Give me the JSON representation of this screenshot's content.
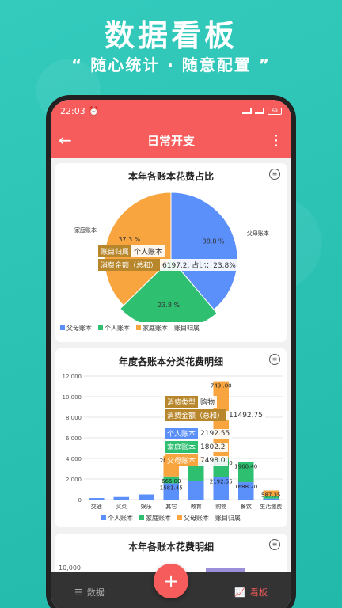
{
  "promo": {
    "title": "数据看板",
    "subtitle": "“ 随心统计 · 随意配置 ”"
  },
  "statusbar": {
    "time": "22:03",
    "battery": "69"
  },
  "appbar": {
    "title": "日常开支"
  },
  "colors": {
    "accent": "#f65c5b",
    "blue": "#5b8ff9",
    "green": "#2fbf71",
    "orange": "#f8a540",
    "brown": "#b8862b",
    "darkbrown": "#8a6d3b"
  },
  "pie_card": {
    "title": "本年各账本花费占比",
    "tooltip": {
      "k1": "账目归属",
      "v1": "个人账本",
      "k2": "消费金额（总和）",
      "v2": "6197.2, 占比：23.8%"
    },
    "legend": [
      "父母账本",
      "个人账本",
      "家庭账本",
      "账目归属"
    ]
  },
  "bar_card": {
    "title": "年度各账本分类花费明细",
    "tooltip": {
      "k1": "消费类型",
      "v1": "购物",
      "k2": "消费金额（总和）",
      "v2": "11492.75",
      "r1k": "个人账本",
      "r1v": "2192.55",
      "r2k": "家庭账本",
      "r2v": "1802.2",
      "r3k": "父母账本",
      "r3v": "7498.0"
    },
    "legend": [
      "个人账本",
      "家庭账本",
      "父母账本",
      "账目归属"
    ]
  },
  "third_card": {
    "title": "本年各账本花费明细",
    "first_tick": "10,000"
  },
  "nav": {
    "data": "数据",
    "board": "看板",
    "add": "+"
  },
  "chart_data": [
    {
      "type": "pie",
      "title": "本年各账本花费占比",
      "labels": [
        "父母账本",
        "个人账本",
        "家庭账本"
      ],
      "values": [
        38.8,
        23.8,
        37.3
      ],
      "value_labels": [
        "38.8 %",
        "23.8 %",
        "37.3 %"
      ],
      "colors": [
        "#5b8ff9",
        "#2fbf71",
        "#f8a540"
      ],
      "legend_position": "bottom"
    },
    {
      "type": "bar",
      "title": "年度各账本分类花费明细",
      "stacked": true,
      "categories": [
        "交通",
        "买菜",
        "娱乐",
        "其它",
        "教育",
        "购物",
        "餐饮",
        "生活缴费"
      ],
      "ylim": [
        0,
        12000
      ],
      "yticks": [
        "0",
        "2,000",
        "4,000",
        "6,000",
        "8,000",
        "10,000",
        "12,000"
      ],
      "series": [
        {
          "name": "个人账本",
          "color": "#5b8ff9",
          "values": [
            150,
            250,
            500,
            1581.45,
            1800,
            2192.55,
            1688.2,
            100
          ]
        },
        {
          "name": "家庭账本",
          "color": "#2fbf71",
          "values": [
            0,
            0,
            0,
            666.0,
            1900,
            1802.2,
            1960.4,
            200
          ]
        },
        {
          "name": "父母账本",
          "color": "#f8a540",
          "values": [
            0,
            0,
            0,
            2000.0,
            500,
            7498.0,
            0,
            587.35
          ]
        }
      ],
      "bar_labels": [
        {
          "category": "其它",
          "series": "个人账本",
          "text": "1581.45"
        },
        {
          "category": "其它",
          "series": "家庭账本",
          "text": "666.00"
        },
        {
          "category": "其它",
          "series": "父母账本",
          "text": "2000.00"
        },
        {
          "category": "购物",
          "series": "个人账本",
          "text": "2192.55"
        },
        {
          "category": "购物",
          "series": "家庭账本",
          "text": "1802.20"
        },
        {
          "category": "购物",
          "series": "父母账本",
          "text": "749 .00"
        },
        {
          "category": "餐饮",
          "series": "个人账本",
          "text": "1688.20"
        },
        {
          "category": "餐饮",
          "series": "家庭账本",
          "text": "1960.40"
        },
        {
          "category": "生活缴费",
          "series": "父母账本",
          "text": "587.35"
        }
      ],
      "legend_position": "bottom"
    }
  ]
}
